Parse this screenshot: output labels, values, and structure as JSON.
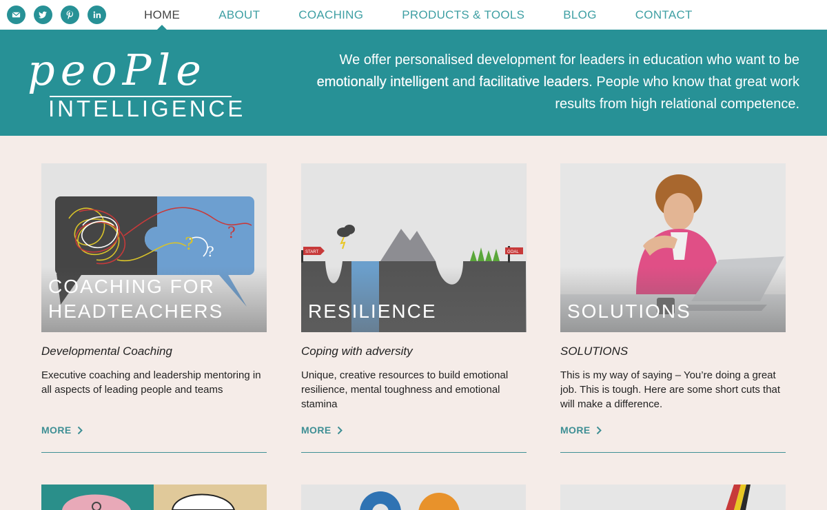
{
  "nav": {
    "items": [
      {
        "label": "HOME",
        "active": true
      },
      {
        "label": "ABOUT",
        "active": false
      },
      {
        "label": "COACHING",
        "active": false
      },
      {
        "label": "PRODUCTS & TOOLS",
        "active": false
      },
      {
        "label": "BLOG",
        "active": false
      },
      {
        "label": "CONTACT",
        "active": false
      }
    ],
    "social": [
      "email-icon",
      "twitter-icon",
      "pinterest-icon",
      "linkedin-icon"
    ]
  },
  "logo": {
    "top": "peoPle",
    "bottom": "INTELLIGENCE"
  },
  "hero": {
    "line1": "We offer personalised development for leaders in education who want to be",
    "em1": "emotionally intelligent",
    "and": " and ",
    "em2": "facilitative leaders",
    "line2_rest": ". People who know that great work",
    "line3": "results from high relational competence."
  },
  "cards": [
    {
      "caption": "COACHING FOR HEADTEACHERS",
      "subtitle": "Developmental Coaching",
      "description": "Executive coaching and leadership mentoring in all aspects of leading people and teams",
      "more": "MORE"
    },
    {
      "caption": "RESILIENCE",
      "subtitle": "Coping with adversity",
      "description": "Unique, creative resources to build emotional resilience, mental toughness and emotional stamina",
      "more": "MORE",
      "art_text": {
        "start": "START",
        "goal": "GOAL"
      }
    },
    {
      "caption": "SOLUTIONS",
      "subtitle": "SOLUTIONS",
      "description": "This is my way of saying – You’re doing a great job. This is tough. Here are some short cuts that will make a difference.",
      "more": "MORE"
    }
  ],
  "colors": {
    "teal": "#279196",
    "nav_text": "#3e9fa3",
    "page_bg": "#f5ece8",
    "link": "#3e8f94"
  }
}
